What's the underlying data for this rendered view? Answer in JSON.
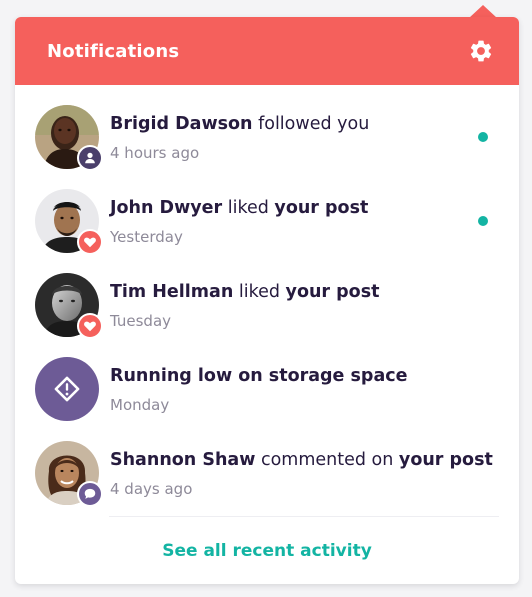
{
  "header": {
    "title": "Notifications",
    "settings_icon": "gear-icon"
  },
  "colors": {
    "accent": "#f5605c",
    "teal": "#13b4a3",
    "badge_user": "#4a3f6b",
    "badge_heart": "#f5605c",
    "storage": "#6d5b96"
  },
  "notifications": [
    {
      "name": "Brigid Dawson",
      "action": " followed you",
      "target": "",
      "time": "4 hours ago",
      "badge_icon": "user-icon",
      "unread": true
    },
    {
      "name": "John Dwyer",
      "action": " liked ",
      "target": "your post",
      "time": "Yesterday",
      "badge_icon": "heart-icon",
      "unread": true
    },
    {
      "name": "Tim Hellman",
      "action": " liked ",
      "target": "your post",
      "time": "Tuesday",
      "badge_icon": "heart-icon",
      "unread": false
    },
    {
      "name": "Running low on storage space",
      "action": "",
      "target": "",
      "time": "Monday",
      "badge_icon": "warning-icon",
      "unread": false
    },
    {
      "name": "Shannon Shaw",
      "action": " commented on ",
      "target": "your post",
      "time": "4 days ago",
      "badge_icon": "comment-icon",
      "unread": false
    }
  ],
  "footer": {
    "link_label": "See all recent activity"
  }
}
